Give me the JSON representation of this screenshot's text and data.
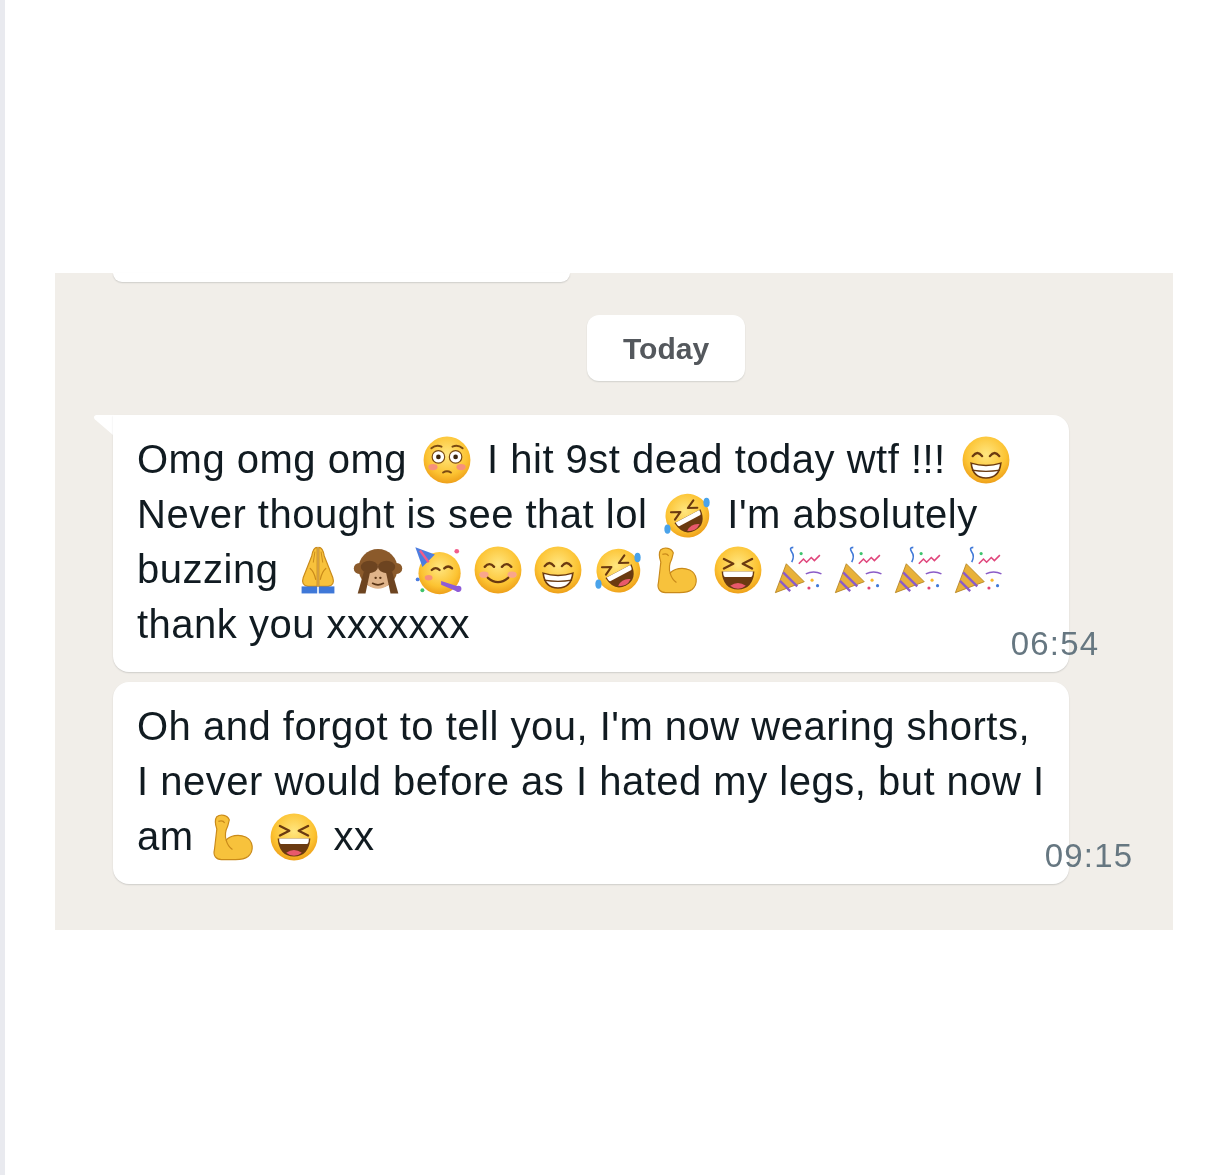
{
  "date_chip": {
    "label": "Today"
  },
  "messages": [
    {
      "tail": true,
      "lines": [
        [
          {
            "kind": "text",
            "text": "Omg omg omg"
          },
          {
            "kind": "flushed"
          },
          {
            "kind": "text",
            "text": "I hit 9st dead today wtf !!!"
          },
          {
            "kind": "grin"
          }
        ],
        [
          {
            "kind": "text",
            "text": "Never thought is see that lol"
          },
          {
            "kind": "rofl"
          },
          {
            "kind": "text",
            "text": "I'm absolutely"
          }
        ],
        [
          {
            "kind": "text",
            "text": "buzzing"
          },
          {
            "kind": "pray"
          },
          {
            "kind": "monkey"
          },
          {
            "kind": "party"
          },
          {
            "kind": "smile"
          },
          {
            "kind": "grin"
          },
          {
            "kind": "rofl"
          },
          {
            "kind": "muscle"
          },
          {
            "kind": "laugh"
          },
          {
            "kind": "popper"
          },
          {
            "kind": "popper"
          },
          {
            "kind": "popper"
          },
          {
            "kind": "popper"
          }
        ],
        [
          {
            "kind": "text",
            "text": "thank you xxxxxxx"
          }
        ]
      ],
      "time": "06:54"
    },
    {
      "tail": false,
      "lines": [
        [
          {
            "kind": "text",
            "text": "Oh and forgot to tell you, I'm now wearing shorts,"
          }
        ],
        [
          {
            "kind": "text",
            "text": "I never would before as I hated my legs, but now I"
          }
        ],
        [
          {
            "kind": "text",
            "text": "am"
          },
          {
            "kind": "muscle"
          },
          {
            "kind": "laugh"
          },
          {
            "kind": "text",
            "text": "xx"
          }
        ]
      ],
      "time": "09:15"
    }
  ]
}
